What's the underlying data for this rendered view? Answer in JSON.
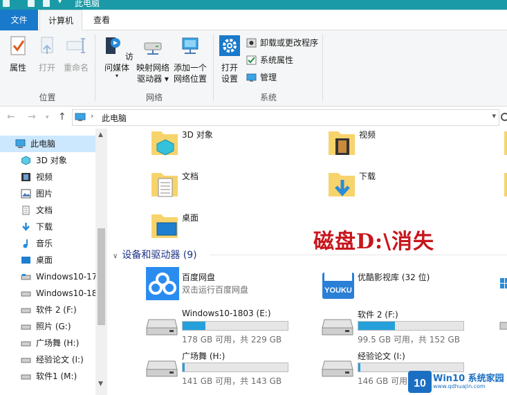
{
  "window": {
    "title": "此电脑"
  },
  "ribbon": {
    "tabs": {
      "file": "文件",
      "computer": "计算机",
      "view": "查看"
    },
    "location": {
      "label": "位置",
      "properties": "属性",
      "open": "打开",
      "rename": "重命名"
    },
    "network": {
      "label": "网络",
      "access_media": "访问媒体",
      "map_drive_1": "映射网络",
      "map_drive_2": "驱动器 ▾",
      "add_location_1": "添加一个",
      "add_location_2": "网络位置"
    },
    "system": {
      "label": "系统",
      "open_settings_1": "打开",
      "open_settings_2": "设置",
      "uninstall": "卸载或更改程序",
      "system_properties": "系统属性",
      "manage": "管理"
    }
  },
  "address": {
    "crumb": "此电脑"
  },
  "nav_pane": {
    "items": [
      {
        "label": "此电脑"
      },
      {
        "label": "3D 对象"
      },
      {
        "label": "视频"
      },
      {
        "label": "图片"
      },
      {
        "label": "文档"
      },
      {
        "label": "下载"
      },
      {
        "label": "音乐"
      },
      {
        "label": "桌面"
      },
      {
        "label": "Windows10-17"
      },
      {
        "label": "Windows10-18"
      },
      {
        "label": "软件 2 (F:)"
      },
      {
        "label": "照片 (G:)"
      },
      {
        "label": "广场舞 (H:)"
      },
      {
        "label": "经验论文 (I:)"
      },
      {
        "label": "软件1 (M:)"
      }
    ]
  },
  "folders": [
    {
      "label": "3D 对象"
    },
    {
      "label": "视频"
    },
    {
      "label": "文档"
    },
    {
      "label": "下载"
    },
    {
      "label": "桌面"
    }
  ],
  "devices_section": {
    "title": "设备和驱动器 (9)"
  },
  "apps": [
    {
      "name": "百度网盘",
      "sub": "双击运行百度网盘"
    },
    {
      "name": "优酷影视库 (32 位)"
    }
  ],
  "drives": [
    {
      "name": "Windows10-1803 (E:)",
      "usage": "178 GB 可用，共 229 GB",
      "used_fraction": 0.22
    },
    {
      "name": "软件 2 (F:)",
      "usage": "99.5 GB 可用，共 152 GB",
      "used_fraction": 0.35
    },
    {
      "name": "广场舞 (H:)",
      "usage": "141 GB 可用，共 143 GB",
      "used_fraction": 0.02
    },
    {
      "name": "经验论文 (I:)",
      "usage": "146 GB 可用",
      "used_fraction": 0.02
    }
  ],
  "overlay_text": "磁盘D:\\消失",
  "watermark": {
    "title": "Win10 系统家园",
    "url": "www.qdhuajin.com"
  },
  "colors": {
    "accent": "#1979ca",
    "titlebar": "#1a9aa6",
    "drive_bar": "#26a0da",
    "overlay": "#c8161d"
  }
}
